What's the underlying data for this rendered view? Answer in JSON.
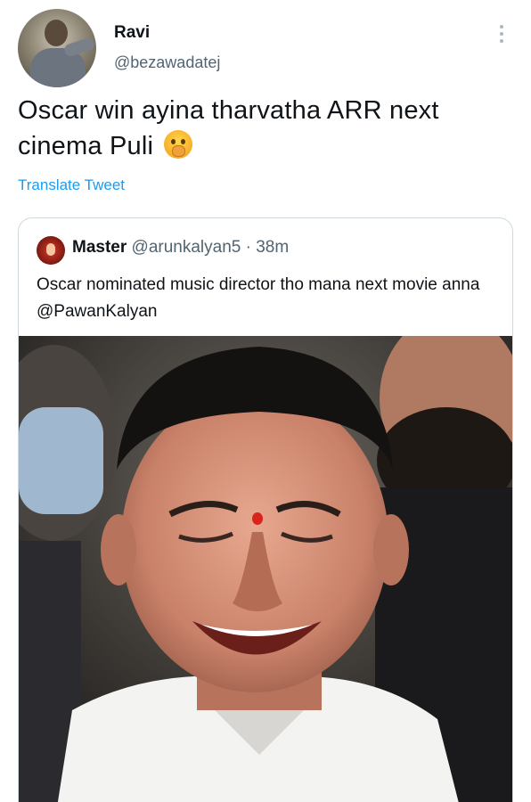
{
  "author": {
    "display_name": "Ravi",
    "handle": "@bezawadatej",
    "avatar": "user-avatar",
    "more_icon": "more-vertical-icon"
  },
  "tweet": {
    "text": "Oscar win ayina tharvatha ARR next cinema Puli",
    "emoji": "face-with-open-eyes-and-hand-over-mouth-emoji",
    "translate_label": "Translate Tweet"
  },
  "quoted_tweet": {
    "display_name": "Master",
    "handle": "@arunkalyan5",
    "separator": "·",
    "timestamp": "38m",
    "text": "Oscar nominated music director tho mana next movie anna @PawanKalyan",
    "media": "photo of a smiling man in a white shirt"
  },
  "colors": {
    "link": "#1d9bf0",
    "secondary_text": "#536471",
    "border": "#cfd9de"
  }
}
